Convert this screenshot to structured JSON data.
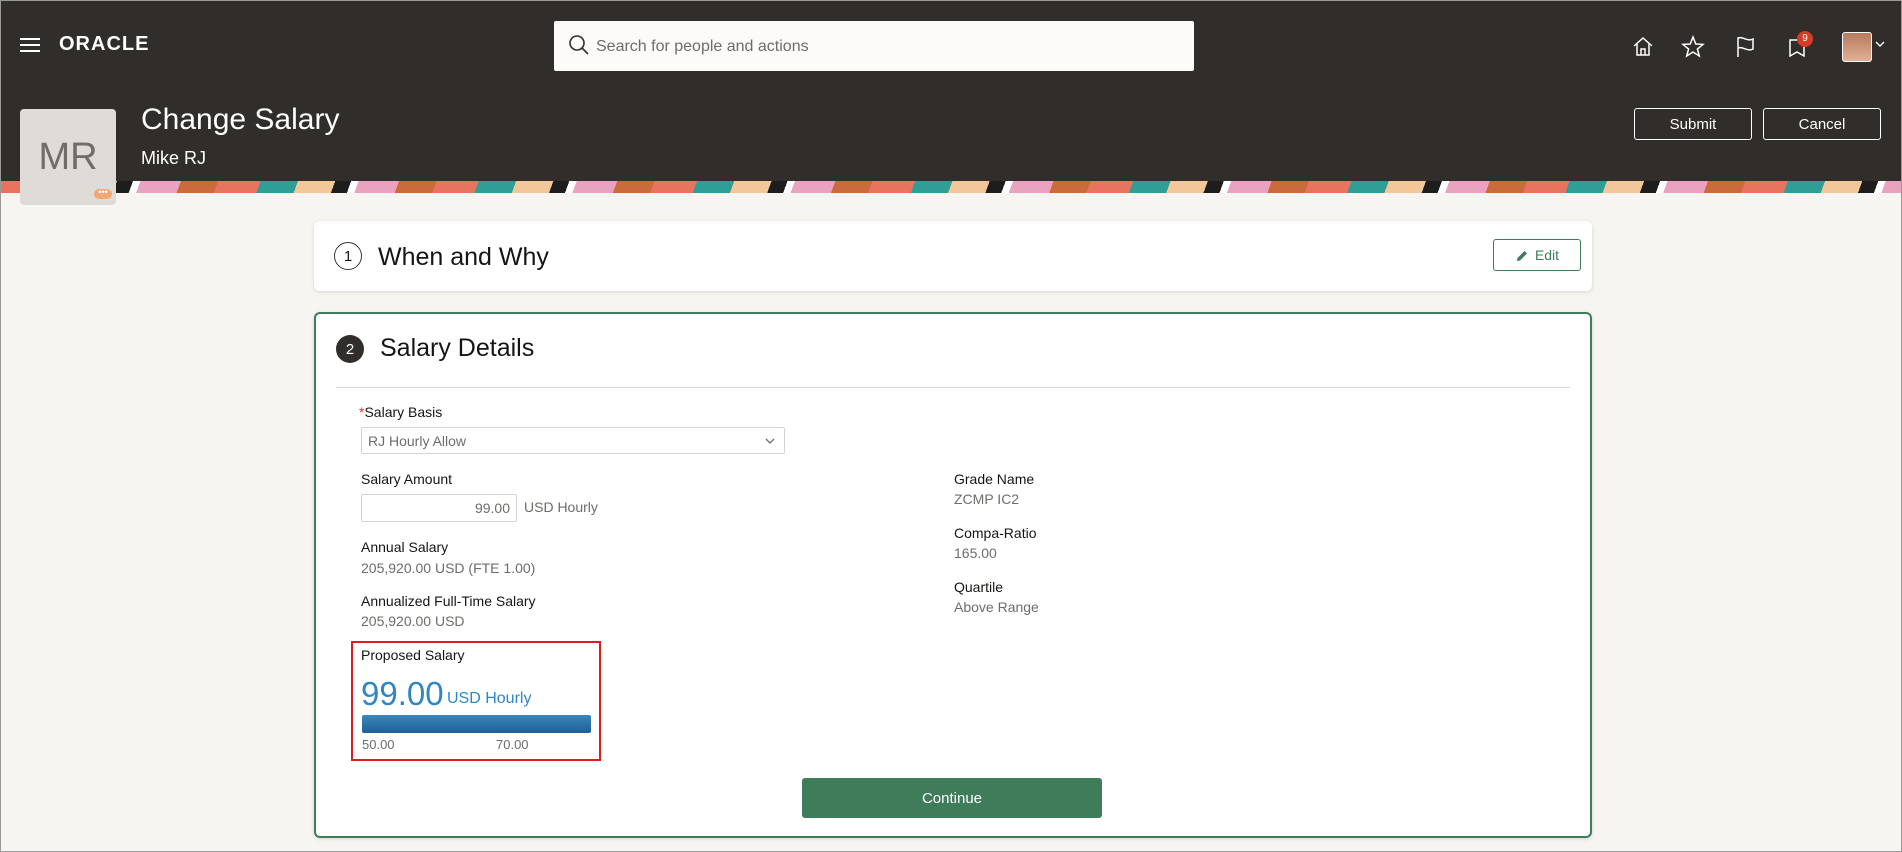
{
  "header": {
    "brand": "ORACLE",
    "search_placeholder": "Search for people and actions",
    "notification_count": "9",
    "icons": [
      "home-icon",
      "star-icon",
      "flag-icon",
      "notifications-icon"
    ]
  },
  "person": {
    "initials": "MR",
    "name": "Mike RJ",
    "more_badge": "•••"
  },
  "page": {
    "title": "Change Salary",
    "submit_label": "Submit",
    "cancel_label": "Cancel"
  },
  "section1": {
    "number": "1",
    "title": "When and Why",
    "edit_label": "Edit"
  },
  "section2": {
    "number": "2",
    "title": "Salary Details",
    "salary_basis_label": "Salary Basis",
    "salary_basis_value": "RJ Hourly Allow",
    "salary_amount_label": "Salary Amount",
    "salary_amount_value": "99.00",
    "salary_amount_unit": "USD Hourly",
    "annual_salary_label": "Annual Salary",
    "annual_salary_value": "205,920.00",
    "annual_salary_unit": "USD (FTE 1.00)",
    "annualized_label": "Annualized Full-Time Salary",
    "annualized_value": "205,920.00",
    "annualized_unit": "USD",
    "grade_name_label": "Grade Name",
    "grade_name_value": "ZCMP IC2",
    "compa_ratio_label": "Compa-Ratio",
    "compa_ratio_value": "165.00",
    "quartile_label": "Quartile",
    "quartile_value": "Above Range",
    "proposed_label": "Proposed Salary",
    "proposed_value": "99.00",
    "proposed_unit": "USD Hourly",
    "range_min": "50.00",
    "range_max": "70.00",
    "range_fill_fraction": 1.0,
    "continue_label": "Continue"
  },
  "colors": {
    "header_bg": "#312d2a",
    "accent_green": "#3f7c5a",
    "proposed_blue": "#2f86c3",
    "highlight_red": "#e01b24"
  }
}
